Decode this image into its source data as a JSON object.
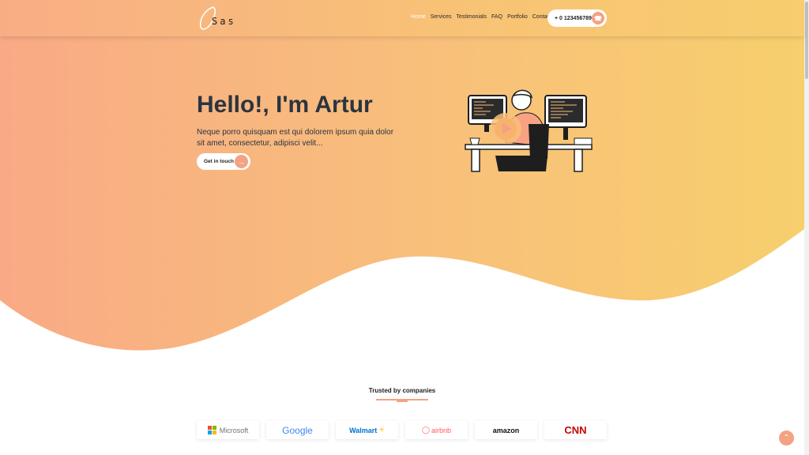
{
  "brand": {
    "logo_text": "Sas"
  },
  "nav": {
    "items": [
      {
        "label": "Home"
      },
      {
        "label": "Services"
      },
      {
        "label": "Testimonials"
      },
      {
        "label": "FAQ"
      },
      {
        "label": "Portfolio"
      },
      {
        "label": "Contact"
      }
    ],
    "active_index": 0,
    "phone_label": "+ 0 123456789"
  },
  "hero": {
    "title": "Hello!, I'm Artur",
    "description": "Neque porro quisquam est qui dolorem ipsum quia dolor sit amet, consectetur, adipisci velit...",
    "cta_label": "Get in touch"
  },
  "trusted": {
    "title": "Trusted by companies",
    "companies": [
      "Microsoft",
      "Google",
      "Walmart",
      "airbnb",
      "amazon",
      "CNN"
    ]
  },
  "colors": {
    "accent": "#f3a283",
    "gradient_start": "#f9ad85",
    "gradient_end": "#f7cd6e",
    "text_dark": "#2b3440"
  },
  "icons": {
    "phone": "phone-icon",
    "arrow": "arrow-right-icon",
    "scroll_top": "chevron-up-icon"
  }
}
